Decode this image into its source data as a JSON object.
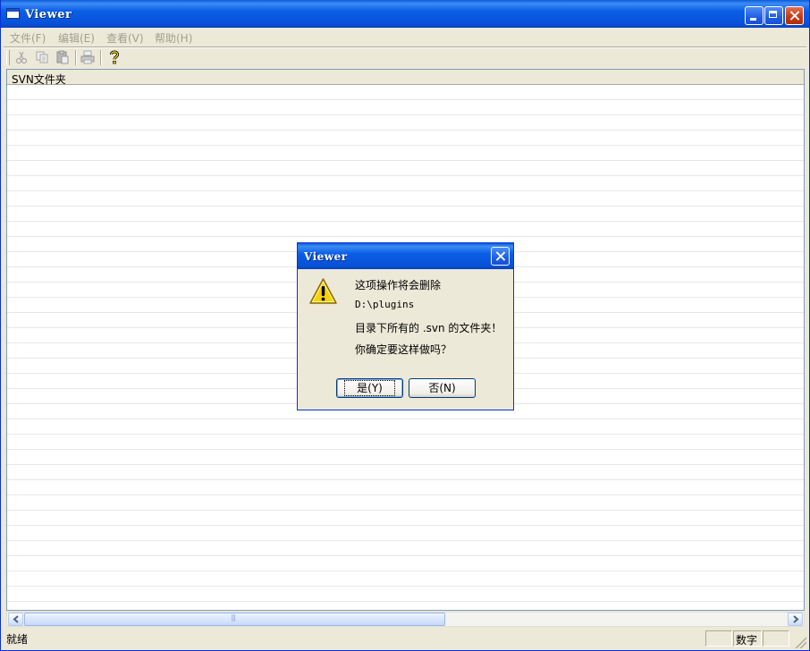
{
  "window": {
    "title": "Viewer"
  },
  "menu": {
    "items": [
      "文件(F)",
      "编辑(E)",
      "查看(V)",
      "帮助(H)"
    ]
  },
  "toolbar": {
    "icons": [
      "cut-icon",
      "copy-icon",
      "paste-icon",
      "print-icon",
      "help-icon"
    ]
  },
  "listview": {
    "column_header": "SVN文件夹"
  },
  "statusbar": {
    "text": "就绪",
    "numlock": "数字"
  },
  "dialog": {
    "title": "Viewer",
    "icon": "warning-icon",
    "line1": "这项操作将会删除",
    "line2": "D:\\plugins",
    "line3": "目录下所有的 .svn 的文件夹！",
    "line4": "你确定要这样做吗？",
    "yes_label": "是(Y)",
    "no_label": "否(N)"
  },
  "colors": {
    "title_bar": "#0b5ee6",
    "close_button": "#c4380f",
    "window_face": "#ece9d8"
  }
}
